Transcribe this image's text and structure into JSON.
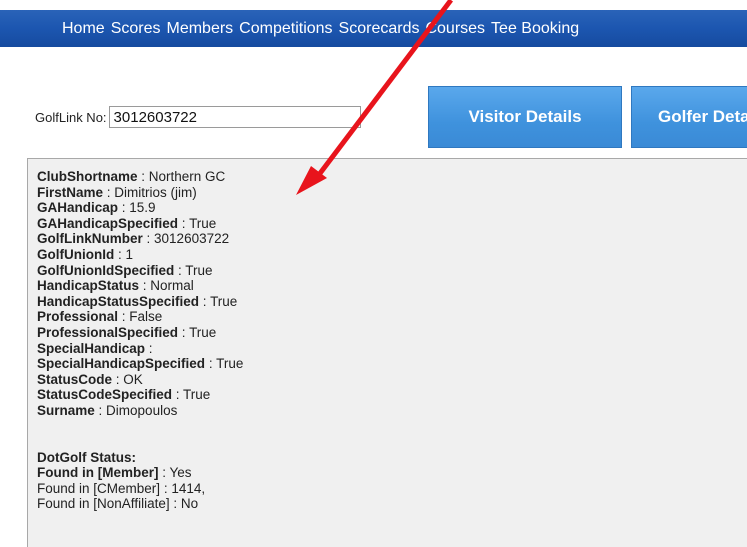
{
  "nav": {
    "items": [
      "Home",
      "Scores",
      "Members",
      "Competitions",
      "Scorecards",
      "Courses",
      "Tee Booking"
    ]
  },
  "golflink": {
    "label": "GolfLink No:",
    "value": "3012603722"
  },
  "buttons": {
    "visitor": "Visitor Details",
    "golfer": "Golfer Details"
  },
  "details": [
    {
      "key": "ClubShortname",
      "value": "Northern GC"
    },
    {
      "key": "FirstName",
      "value": "Dimitrios (jim)"
    },
    {
      "key": "GAHandicap",
      "value": "15.9"
    },
    {
      "key": "GAHandicapSpecified",
      "value": "True"
    },
    {
      "key": "GolfLinkNumber",
      "value": "3012603722"
    },
    {
      "key": "GolfUnionId",
      "value": "1"
    },
    {
      "key": "GolfUnionIdSpecified",
      "value": "True"
    },
    {
      "key": "HandicapStatus",
      "value": "Normal"
    },
    {
      "key": "HandicapStatusSpecified",
      "value": "True"
    },
    {
      "key": "Professional",
      "value": "False"
    },
    {
      "key": "ProfessionalSpecified",
      "value": "True"
    },
    {
      "key": "SpecialHandicap",
      "value": ""
    },
    {
      "key": "SpecialHandicapSpecified",
      "value": "True"
    },
    {
      "key": "StatusCode",
      "value": "OK"
    },
    {
      "key": "StatusCodeSpecified",
      "value": "True"
    },
    {
      "key": "Surname",
      "value": "Dimopoulos"
    }
  ],
  "dotgolf": {
    "title": "DotGolf Status:",
    "rows": [
      {
        "key": "Found in [Member]",
        "value": "Yes",
        "bold": true
      },
      {
        "key": "Found in [CMember]",
        "value": "1414,",
        "bold": false
      },
      {
        "key": "Found in [NonAffiliate]",
        "value": "No",
        "bold": false
      }
    ]
  },
  "colors": {
    "nav_bar": "#1c56b0",
    "button": "#4a9be4",
    "panel_bg": "#f0f0f0",
    "arrow": "#e8141c"
  },
  "icons": {
    "annotation": "red-arrow"
  }
}
